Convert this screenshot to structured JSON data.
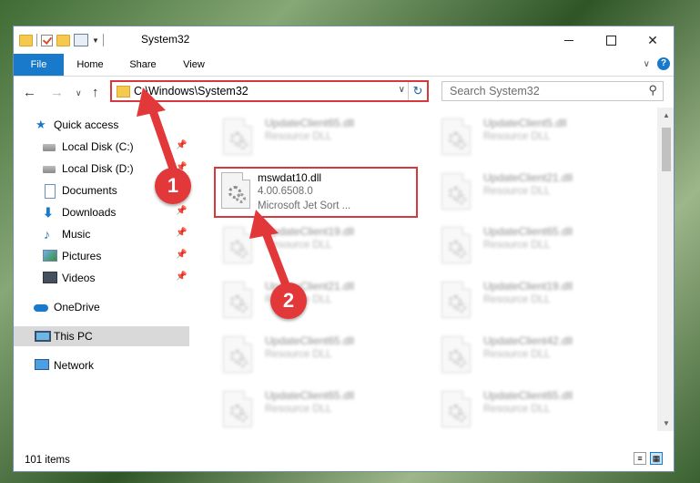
{
  "window": {
    "title": "System32",
    "controls": {
      "minimize": "minimize",
      "maximize": "maximize",
      "close": "✕"
    }
  },
  "ribbon": {
    "tabs": [
      "File",
      "Home",
      "Share",
      "View"
    ]
  },
  "address_bar": {
    "path": "C:\\Windows\\System32",
    "search_placeholder": "Search System32"
  },
  "nav_pane": {
    "quick_access": "Quick access",
    "items": [
      {
        "label": "Local Disk (C:)",
        "icon": "disk-icon",
        "pinned": true
      },
      {
        "label": "Local Disk (D:)",
        "icon": "disk-icon",
        "pinned": true
      },
      {
        "label": "Documents",
        "icon": "documents-icon",
        "pinned": true
      },
      {
        "label": "Downloads",
        "icon": "downloads-icon",
        "pinned": true
      },
      {
        "label": "Music",
        "icon": "music-icon",
        "pinned": true
      },
      {
        "label": "Pictures",
        "icon": "pictures-icon",
        "pinned": true
      },
      {
        "label": "Videos",
        "icon": "videos-icon",
        "pinned": true
      }
    ],
    "onedrive": "OneDrive",
    "this_pc": "This PC",
    "network": "Network"
  },
  "files": {
    "left_column": [
      {
        "name": "UpdateClient65.dll",
        "desc": "Resource DLL"
      },
      {
        "name": "mswdat10.dll",
        "version": "4.00.6508.0",
        "desc": "Microsoft Jet Sort ...",
        "highlighted": true
      },
      {
        "name": "UpdateClient19.dll",
        "desc": "Resource DLL"
      },
      {
        "name": "UpdateClient21.dll",
        "desc": "Resource DLL"
      },
      {
        "name": "UpdateClient65.dll",
        "desc": "Resource DLL"
      },
      {
        "name": "UpdateClient65.dll",
        "desc": "Resource DLL"
      }
    ],
    "right_column": [
      {
        "name": "UpdateClient5.dll",
        "desc": "Resource DLL"
      },
      {
        "name": "UpdateClient21.dll",
        "desc": "Resource DLL"
      },
      {
        "name": "UpdateClient65.dll",
        "desc": "Resource DLL"
      },
      {
        "name": "UpdateClient19.dll",
        "desc": "Resource DLL"
      },
      {
        "name": "UpdateClient42.dll",
        "desc": "Resource DLL"
      },
      {
        "name": "UpdateClient65.dll",
        "desc": "Resource DLL"
      }
    ]
  },
  "status_bar": {
    "item_count": "101 items"
  },
  "annotations": {
    "step1": "1",
    "step2": "2",
    "color": "#e2383a"
  }
}
